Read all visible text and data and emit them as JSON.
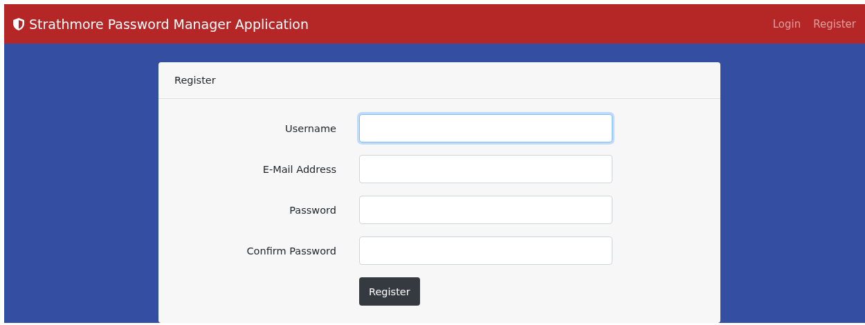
{
  "navbar": {
    "brand": "Strathmore Password Manager Application",
    "links": [
      {
        "label": "Login"
      },
      {
        "label": "Register"
      }
    ]
  },
  "card": {
    "header": "Register",
    "fields": [
      {
        "label": "Username",
        "focused": true
      },
      {
        "label": "E-Mail Address",
        "focused": false
      },
      {
        "label": "Password",
        "focused": false
      },
      {
        "label": "Confirm Password",
        "focused": false
      }
    ],
    "button": "Register"
  }
}
